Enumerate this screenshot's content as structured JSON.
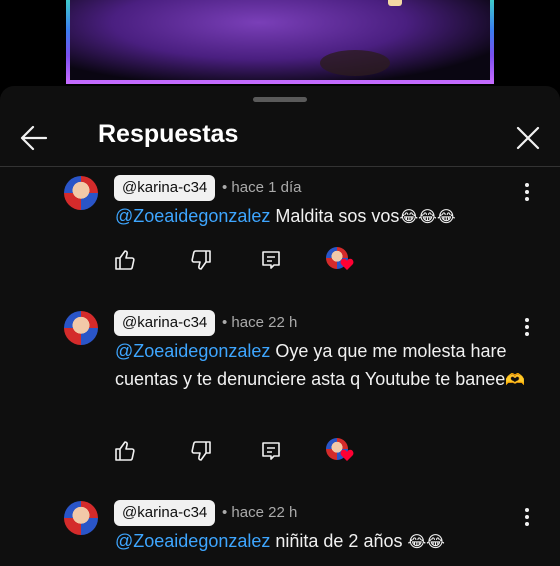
{
  "header": {
    "title": "Respuestas"
  },
  "icons": {
    "back": "arrow-left-icon",
    "close": "close-icon",
    "more": "more-vert-icon",
    "like": "thumb-up-icon",
    "dislike": "thumb-down-icon",
    "reply": "comment-reply-icon",
    "creator_heart": "creator-heart-icon"
  },
  "colors": {
    "accent_link": "#3ea6ff",
    "background": "#0f0f0f",
    "heart": "#ff0033"
  },
  "comments": [
    {
      "author": "@karina-c34",
      "time": "• hace 1 día",
      "mention": "@Zoeaidegonzalez",
      "text": " Maldita sos vos",
      "emoji": "😂😂😂"
    },
    {
      "author": "@karina-c34",
      "time": "• hace 22 h",
      "mention": "@Zoeaidegonzalez",
      "text": " Oye ya que me molesta hare cuentas y te denunciere asta q Youtube te banee",
      "emoji": "🫶"
    },
    {
      "author": "@karina-c34",
      "time": "• hace 22 h",
      "mention": "@Zoeaidegonzalez",
      "text": " niñita de 2 años ",
      "emoji": "😂😂"
    }
  ]
}
